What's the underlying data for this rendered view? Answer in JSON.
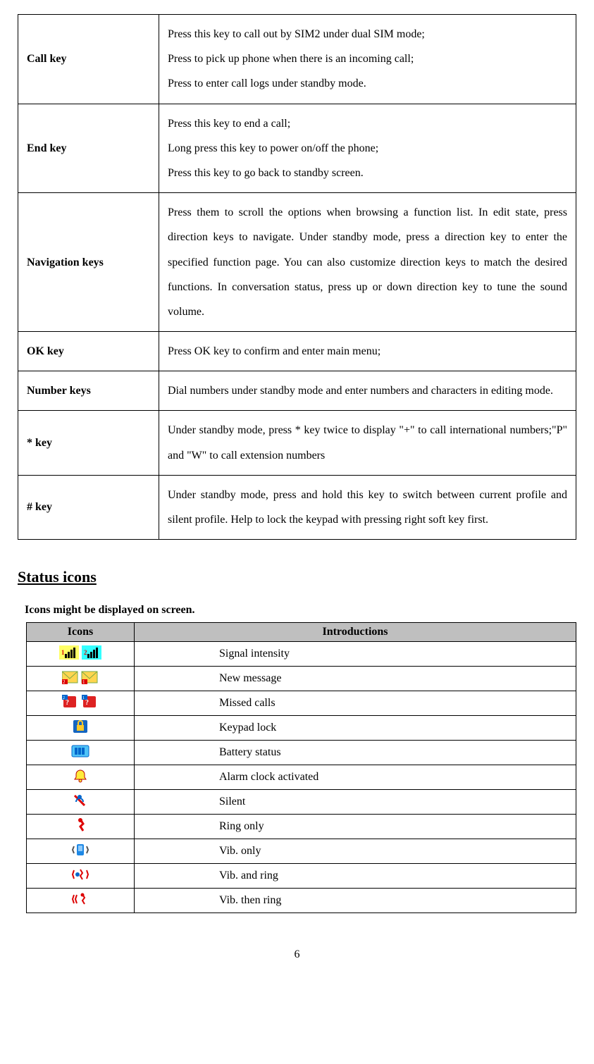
{
  "keys_table": [
    {
      "name": "Call key",
      "desc": "Press this key to call out by SIM2 under dual SIM mode;\nPress to pick up phone when there is an incoming call;\nPress to enter call logs under standby mode."
    },
    {
      "name": "End key",
      "desc": "Press this key to end a call;\nLong press this key to power on/off the phone;\nPress this key to go back to standby screen."
    },
    {
      "name": "Navigation keys",
      "desc": "Press them to scroll the options when browsing a function list. In edit state, press direction keys to navigate. Under standby mode, press a direction key to enter the specified function page. You can also customize direction keys to match the desired functions. In conversation status, press up or down direction key to tune the sound volume."
    },
    {
      "name": "OK key",
      "desc": "Press OK key to confirm and enter main menu;"
    },
    {
      "name": "Number keys",
      "desc": "Dial numbers under standby mode and enter numbers and characters in editing mode."
    },
    {
      "name": "* key",
      "desc": "Under standby mode, press * key twice to display \"+\" to call international numbers;\"P\" and \"W\" to call extension numbers"
    },
    {
      "name": "# key",
      "desc": "Under standby mode, press and hold this key to switch between current profile and silent profile. Help to lock the keypad with pressing right soft key first."
    }
  ],
  "section_heading": "Status icons",
  "icons_subhead": "Icons might be displayed on screen.",
  "icons_table": {
    "header_icons": "Icons",
    "header_intro": "Introductions",
    "rows": [
      {
        "icon_kind": "signal",
        "intro": "Signal intensity"
      },
      {
        "icon_kind": "message",
        "intro": "New message"
      },
      {
        "icon_kind": "missed",
        "intro": "Missed calls"
      },
      {
        "icon_kind": "keypad",
        "intro": "Keypad lock"
      },
      {
        "icon_kind": "battery",
        "intro": "Battery status"
      },
      {
        "icon_kind": "alarm",
        "intro": "Alarm clock activated"
      },
      {
        "icon_kind": "silent",
        "intro": "Silent"
      },
      {
        "icon_kind": "ringonly",
        "intro": "Ring only"
      },
      {
        "icon_kind": "vibonly",
        "intro": "Vib. only"
      },
      {
        "icon_kind": "vibring",
        "intro": "Vib. and ring"
      },
      {
        "icon_kind": "vibthen",
        "intro": "Vib. then ring"
      }
    ]
  },
  "page_number": "6"
}
